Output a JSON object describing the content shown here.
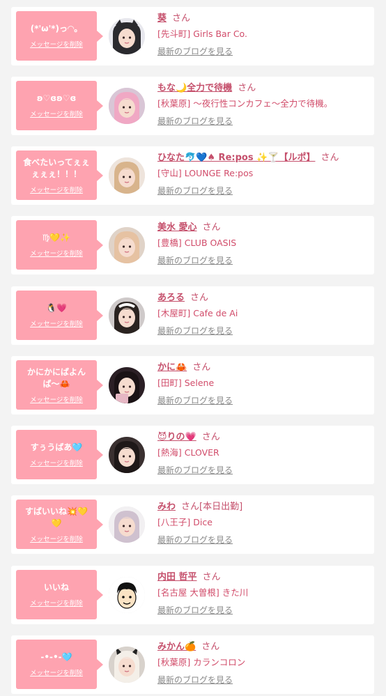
{
  "honorific": "さん",
  "delete_label": "メッセージを削除",
  "blog_label": "最新のブログを見る",
  "colors": {
    "page_background": "#f3f3f3",
    "card_background": "#ffffff",
    "bubble": "#fea3b0",
    "accent": "#c5506c",
    "muted": "#8a8a8a"
  },
  "messages": [
    {
      "bubble_text": "(*'ω'*)っ◜◝。",
      "name": "葵",
      "note": "",
      "shop": "[先斗町] Girls Bar Co.",
      "avatar": "avatar-cat"
    },
    {
      "bubble_text": "ʚ♡ɞʚ♡ɞ",
      "name": "もな🌙全力で待機",
      "note": "",
      "shop": "[秋葉原] 〜夜行性コンカフェ〜全力で待機。",
      "avatar": "avatar-pink-hair"
    },
    {
      "bubble_text": "食べたいってぇぇぇぇぇ！！！",
      "name": "ひなた🐬💙♠ Re:pos ✨🍸【ルポ】",
      "note": "",
      "shop": "[守山] LOUNGE Re:pos",
      "avatar": "avatar-blonde"
    },
    {
      "bubble_text": "♍💛✨",
      "name": "美水 愛心",
      "note": "",
      "shop": "[豊橋] CLUB OASIS",
      "avatar": "avatar-light-hair"
    },
    {
      "bubble_text": "🐧💗",
      "name": "あろる",
      "note": "",
      "shop": "[木屋町] Cafe de Ai",
      "avatar": "avatar-maid"
    },
    {
      "bubble_text": "かにかにばよんば〜🦀",
      "name": "かに🦀",
      "note": "",
      "shop": "[田町] Selene",
      "avatar": "avatar-dark"
    },
    {
      "bubble_text": "すぅうばあ🩵",
      "name": "😈りの💗",
      "note": "",
      "shop": "[熱海] CLOVER",
      "avatar": "avatar-dark-hair"
    },
    {
      "bubble_text": "すばいいね💥💛💛",
      "name": "みわ",
      "note": "[本日出勤]",
      "shop": "[八王子] Dice",
      "avatar": "avatar-ash-hair"
    },
    {
      "bubble_text": "いいね",
      "name": "内田 哲平",
      "note": "",
      "shop": "[名古屋 大曽根] きた川",
      "avatar": "avatar-cartoon"
    },
    {
      "bubble_text": "-•-•-🩵",
      "name": "みかん🍊",
      "note": "",
      "shop": "[秋葉原] カランコロン",
      "avatar": "avatar-bunny"
    }
  ]
}
